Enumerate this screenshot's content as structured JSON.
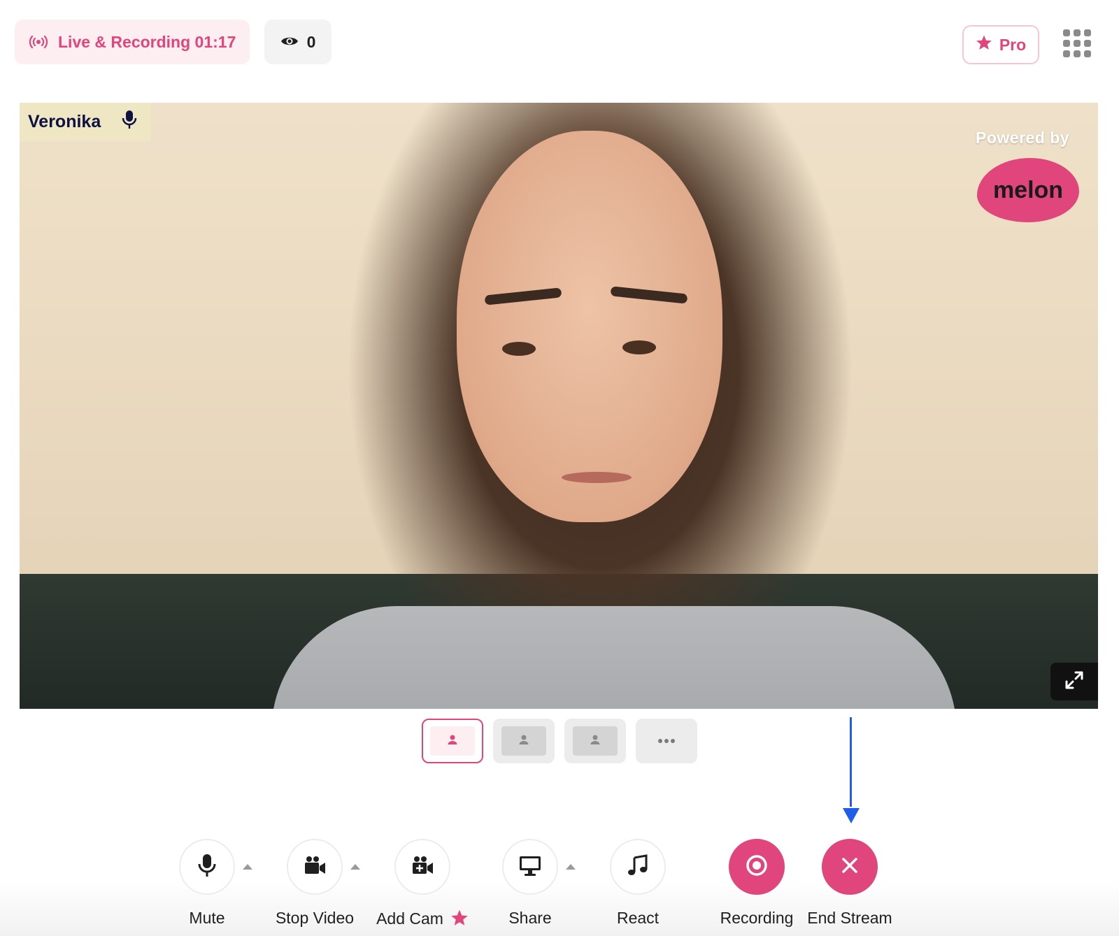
{
  "status": {
    "live_label": "Live & Recording 01:17",
    "viewer_count": "0",
    "pro_label": "Pro"
  },
  "video": {
    "participant_name": "Veronika",
    "powered_by": "Powered by",
    "brand": "melon"
  },
  "toolbar": {
    "mute": "Mute",
    "stop_video": "Stop Video",
    "add_cam": "Add Cam",
    "share": "Share",
    "react": "React",
    "recording": "Recording",
    "end_stream": "End Stream"
  },
  "colors": {
    "accent": "#e0457b",
    "arrow": "#1e5ee8",
    "name_tag_bg": "#efe6c4",
    "name_tag_text": "#0d1240"
  },
  "icons": [
    "broadcast-icon",
    "eye-icon",
    "star-icon",
    "apps-grid-icon",
    "microphone-icon",
    "expand-icon",
    "person-icon",
    "more-icon",
    "video-camera-icon",
    "add-camera-icon",
    "monitor-icon",
    "music-note-icon",
    "record-icon",
    "close-icon"
  ]
}
